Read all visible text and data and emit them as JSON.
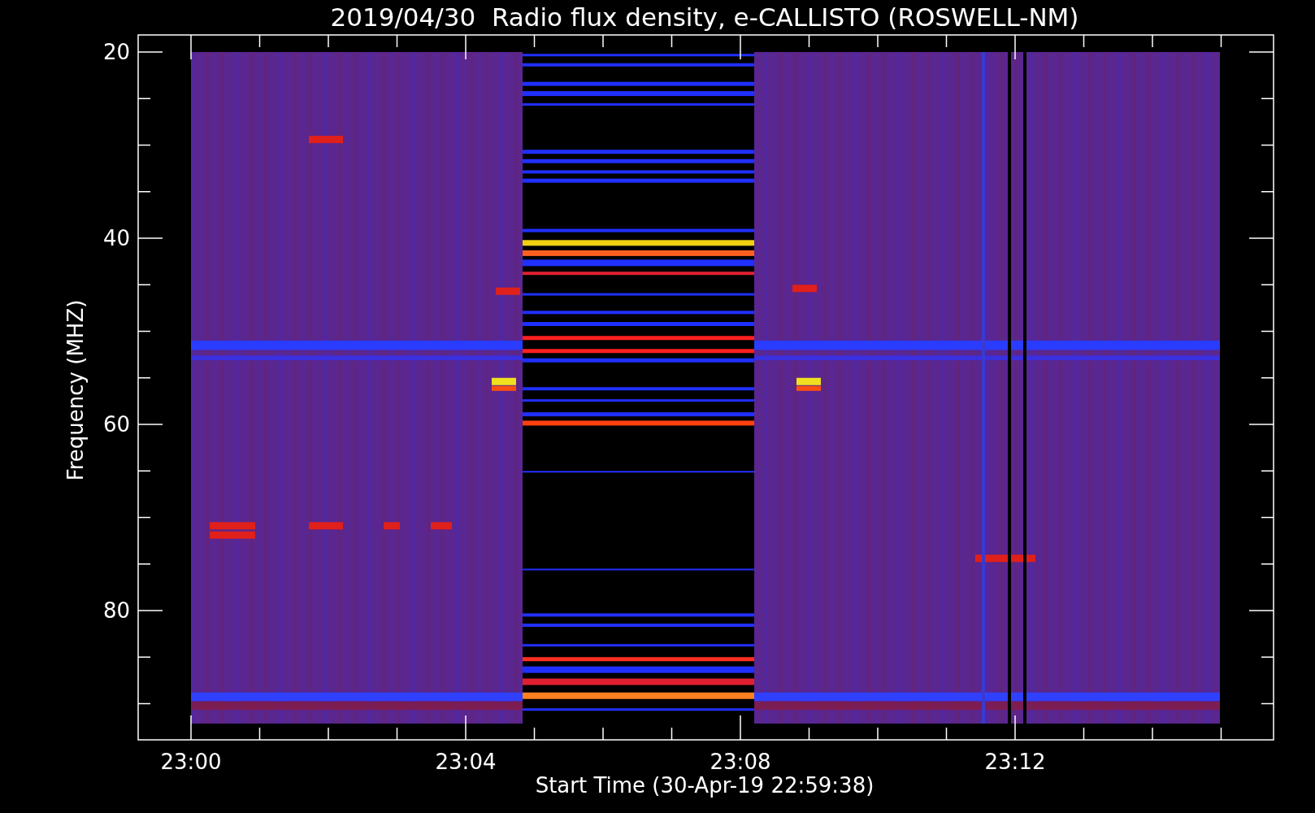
{
  "title": "2019/04/30  Radio flux density, e-CALLISTO (ROSWELL-NM)",
  "ylabel": "Frequency (MHZ)",
  "xlabel": "Start Time (30-Apr-19 22:59:38)",
  "yticks": [
    "20",
    "40",
    "60",
    "80"
  ],
  "xticks": [
    "23:00",
    "23:04",
    "23:08",
    "23:12"
  ]
}
